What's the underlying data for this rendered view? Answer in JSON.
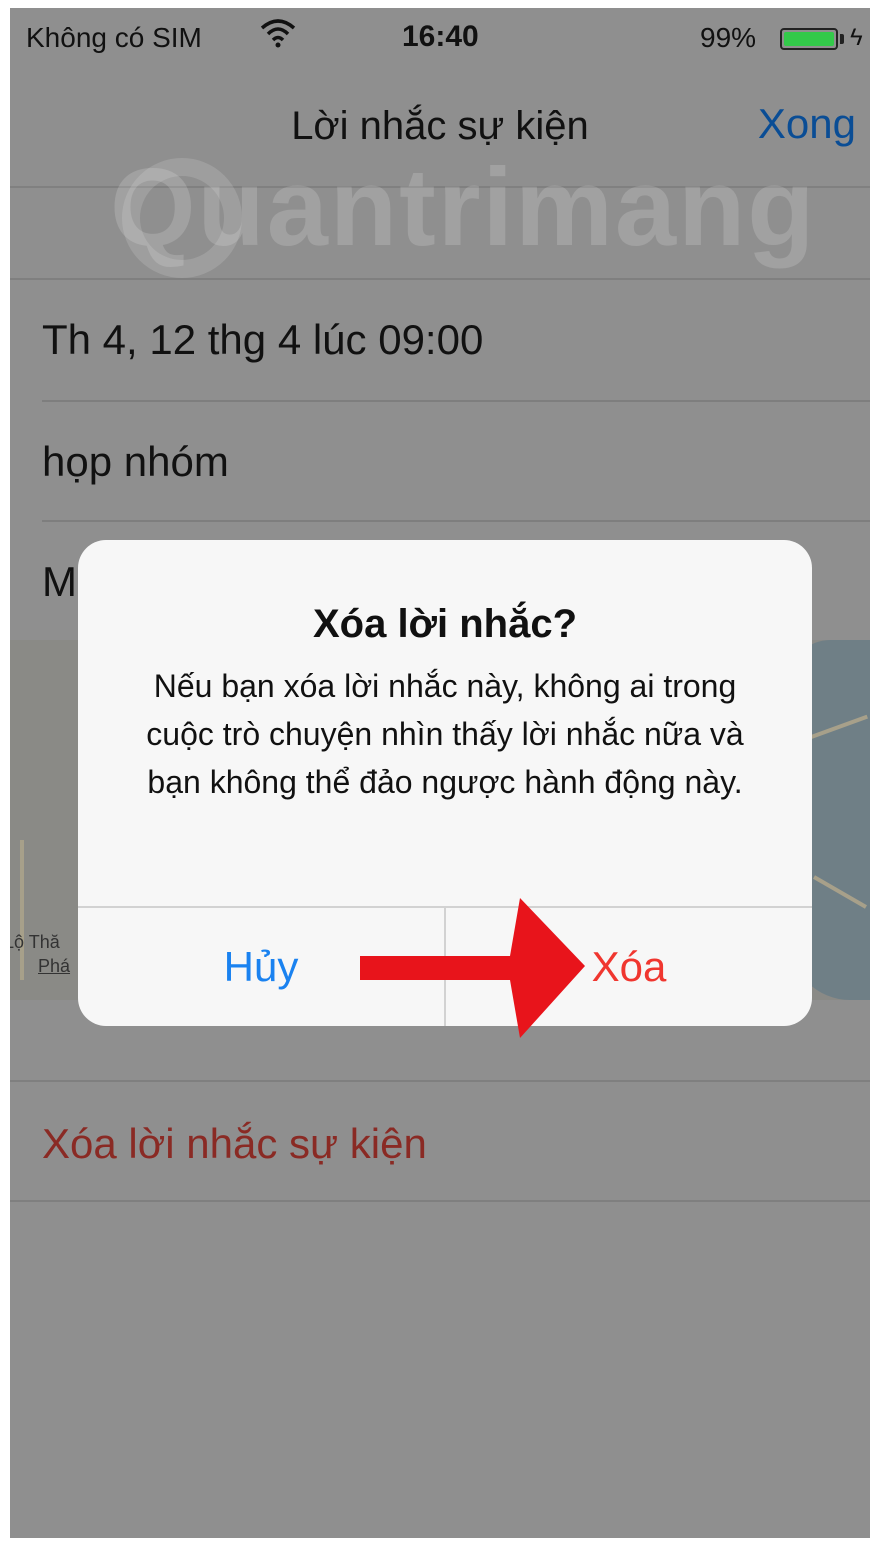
{
  "status_bar": {
    "carrier": "Không có SIM",
    "time": "16:40",
    "battery_percent": "99%",
    "battery_level": 0.99,
    "battery_color": "#33c94a"
  },
  "nav": {
    "title": "Lời nhắc sự kiện",
    "done_label": "Xong"
  },
  "watermark": "Quantrimang",
  "details": {
    "datetime": "Th 4, 12 thg 4 lúc 09:00",
    "note": "họp nhóm",
    "location_partial": "M"
  },
  "map": {
    "label_1": "Lộ Thă",
    "label_2": "Phá"
  },
  "delete_row_label": "Xóa lời nhắc sự kiện",
  "alert": {
    "title": "Xóa lời nhắc?",
    "message": "Nếu bạn xóa lời nhắc này, không ai trong cuộc trò chuyện nhìn thấy lời nhắc nữa và bạn không thể đảo ngược hành động này.",
    "cancel_label": "Hủy",
    "delete_label": "Xóa",
    "cancel_color": "#1a82f0",
    "delete_color": "#f0362f"
  },
  "annotation": {
    "arrow_color": "#e8141b"
  }
}
